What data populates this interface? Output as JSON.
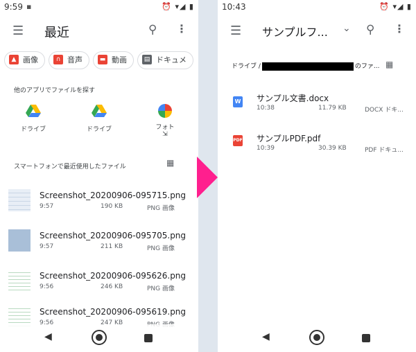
{
  "left": {
    "status_time": "9:59",
    "status_notif": "▪",
    "status_icons": "⏰ ▾◢ ▮",
    "menu_glyph": "☰",
    "title": "最近",
    "search_glyph": "⚲",
    "more_glyph": "⋮",
    "chips": [
      {
        "label": "画像",
        "icon": "image-icon",
        "color": "#ea4335"
      },
      {
        "label": "音声",
        "icon": "headphones-icon",
        "color": "#ea4335"
      },
      {
        "label": "動画",
        "icon": "video-icon",
        "color": "#ea4335"
      },
      {
        "label": "ドキュメ",
        "icon": "document-icon",
        "color": "#5f6368"
      }
    ],
    "apps_heading": "他のアプリでファイルを探す",
    "apps": [
      {
        "label": "ドライブ",
        "icon": "drive-icon"
      },
      {
        "label": "ドライブ",
        "icon": "drive-icon"
      },
      {
        "label": "フォト",
        "icon": "photos-icon",
        "sub": "⇲"
      }
    ],
    "recent_heading": "スマートフォンで最近使用したファイル",
    "grid_glyph": "▦",
    "files": [
      {
        "name": "Screenshot_20200906-095715.png",
        "time": "9:57",
        "size": "190 KB",
        "type": "PNG 画像"
      },
      {
        "name": "Screenshot_20200906-095705.png",
        "time": "9:57",
        "size": "211 KB",
        "type": "PNG 画像"
      },
      {
        "name": "Screenshot_20200906-095626.png",
        "time": "9:56",
        "size": "246 KB",
        "type": "PNG 画像"
      },
      {
        "name": "Screenshot_20200906-095619.png",
        "time": "9:56",
        "size": "247 KB",
        "type": "PNG 画像"
      }
    ],
    "nav_back": "◀"
  },
  "right": {
    "status_time": "10:43",
    "status_icons": "⏰ ▾◢ ▮",
    "menu_glyph": "☰",
    "title": "サンプルフ...",
    "dropdown_glyph": "⌄",
    "search_glyph": "⚲",
    "more_glyph": "⋮",
    "path_prefix": "ドライブ /",
    "path_suffix": "のファ...",
    "grid_glyph": "▦",
    "files": [
      {
        "name": "サンプル文書.docx",
        "time": "10:38",
        "size": "11.79 KB",
        "type": "DOCX ドキ...",
        "icon_label": "W",
        "icon_color": "#4285f4"
      },
      {
        "name": "サンプルPDF.pdf",
        "time": "10:39",
        "size": "30.39 KB",
        "type": "PDF ドキュ...",
        "icon_label": "PDF",
        "icon_color": "#ea4335"
      }
    ],
    "nav_back": "◀"
  },
  "colors": {
    "arrow": "#ff1f8e",
    "separator": "#dfe6ee"
  }
}
